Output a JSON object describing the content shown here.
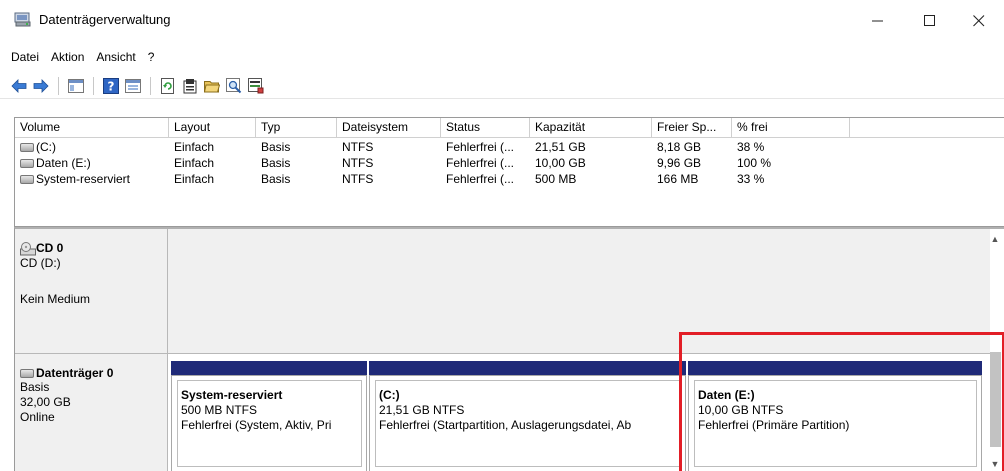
{
  "window": {
    "title": "Datenträgerverwaltung",
    "minimize": "—",
    "maximize": "☐",
    "close": "✕"
  },
  "menu": [
    "Datei",
    "Aktion",
    "Ansicht",
    "?"
  ],
  "toolbar_icons": [
    "back-arrow-icon",
    "forward-arrow-icon",
    "console-tree-icon",
    "help-icon",
    "details-icon",
    "refresh-icon",
    "properties-icon",
    "open-folder-icon",
    "search-icon",
    "disk-manage-icon"
  ],
  "volume_table": {
    "columns": [
      "Volume",
      "Layout",
      "Typ",
      "Dateisystem",
      "Status",
      "Kapazität",
      "Freier Sp...",
      "% frei"
    ],
    "rows": [
      [
        "(C:)",
        "Einfach",
        "Basis",
        "NTFS",
        "Fehlerfrei (...",
        "21,51 GB",
        "8,18 GB",
        "38 %"
      ],
      [
        "Daten (E:)",
        "Einfach",
        "Basis",
        "NTFS",
        "Fehlerfrei (...",
        "10,00 GB",
        "9,96 GB",
        "100 %"
      ],
      [
        "System-reserviert",
        "Einfach",
        "Basis",
        "NTFS",
        "Fehlerfrei (...",
        "500 MB",
        "166 MB",
        "33 %"
      ]
    ]
  },
  "disks": {
    "cd": {
      "name": "CD 0",
      "line1": "CD (D:)",
      "line2": "Kein Medium"
    },
    "disk0": {
      "name": "Datenträger 0",
      "line1": "Basis",
      "line2": "32,00 GB",
      "line3": "Online",
      "partitions": [
        {
          "name": "System-reserviert",
          "size": "500 MB NTFS",
          "status": "Fehlerfrei (System, Aktiv, Pri"
        },
        {
          "name": "(C:)",
          "size": "21,51 GB NTFS",
          "status": "Fehlerfrei (Startpartition, Auslagerungsdatei, Ab"
        },
        {
          "name": "Daten  (E:)",
          "size": "10,00 GB NTFS",
          "status": "Fehlerfrei (Primäre Partition)"
        }
      ]
    }
  },
  "colors": {
    "partition_bar": "#1f2a78",
    "highlight": "#e21e26",
    "panel_bg": "#f0f0f0"
  }
}
